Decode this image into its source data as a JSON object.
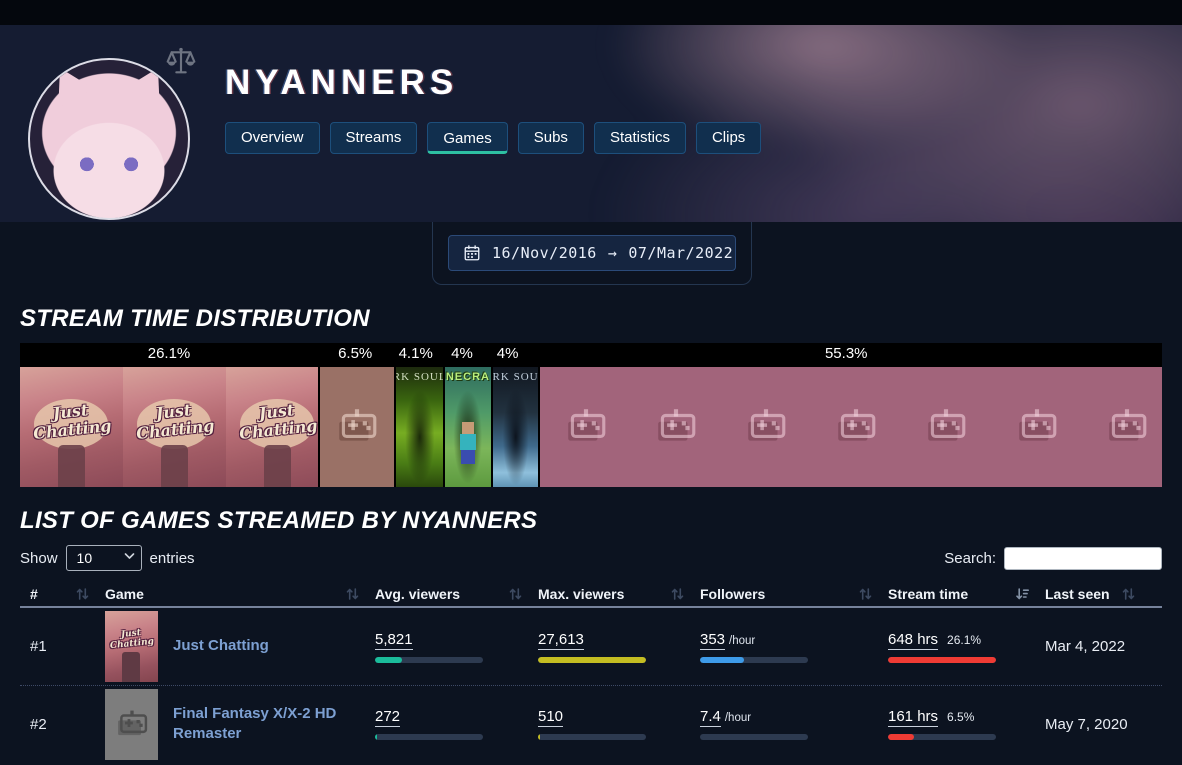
{
  "colors": {
    "accent-active-tab": "#2ec0a2",
    "bar-teal": "#1bbc9b",
    "bar-yellow": "#c4bd22",
    "bar-blue": "#3e9be9",
    "bar-red": "#ef3b34",
    "bar-track": "#2d3a50",
    "link": "#7da0d2"
  },
  "header": {
    "title": "NYANNERS",
    "tabs": [
      {
        "label": "Overview",
        "active": false
      },
      {
        "label": "Streams",
        "active": false
      },
      {
        "label": "Games",
        "active": true
      },
      {
        "label": "Subs",
        "active": false
      },
      {
        "label": "Statistics",
        "active": false
      },
      {
        "label": "Clips",
        "active": false
      }
    ]
  },
  "date_filter": {
    "start": "16/Nov/2016",
    "arrow": "→",
    "end": "07/Mar/2022"
  },
  "sections": {
    "distribution": "STREAM TIME DISTRIBUTION",
    "games": "LIST OF GAMES STREAMED BY NYANNERS"
  },
  "chart_data": {
    "type": "bar",
    "variant": "stacked-percentage-strip",
    "title": "STREAM TIME DISTRIBUTION",
    "unit": "% of total stream time",
    "segments": [
      {
        "label": "26.1%",
        "value": 26.1,
        "art": "just-chatting",
        "tile_text": "Just Chatting"
      },
      {
        "label": "6.5%",
        "value": 6.5,
        "art": "placeholder-brown",
        "tile_text": ""
      },
      {
        "label": "4.1%",
        "value": 4.1,
        "art": "boxart-green",
        "tile_text": "RK SOUL"
      },
      {
        "label": "4%",
        "value": 4,
        "art": "minecraft",
        "tile_text": "NECRA"
      },
      {
        "label": "4%",
        "value": 4,
        "art": "boxart-blue",
        "tile_text": "RK SOU"
      },
      {
        "label": "55.3%",
        "value": 55.3,
        "art": "placeholder-pink",
        "tile_text": ""
      }
    ]
  },
  "games_section": {
    "show_label": "Show",
    "page_size": "10",
    "entries_label": "entries",
    "search_label": "Search:",
    "search_value": ""
  },
  "table": {
    "columns": [
      {
        "label": "#",
        "sort": "both"
      },
      {
        "label": "Game",
        "sort": "both"
      },
      {
        "label": "Avg. viewers",
        "sort": "both"
      },
      {
        "label": "Max. viewers",
        "sort": "both"
      },
      {
        "label": "Followers",
        "sort": "both"
      },
      {
        "label": "Stream time",
        "sort": "desc"
      },
      {
        "label": "Last seen",
        "sort": "both"
      }
    ],
    "rows": [
      {
        "rank": "#1",
        "game": "Just Chatting",
        "thumb": "just-chatting",
        "avg_viewers": {
          "value": "5,821",
          "bar_pct": 25
        },
        "max_viewers": {
          "value": "27,613",
          "bar_pct": 100
        },
        "followers": {
          "value": "353",
          "unit": "/hour",
          "bar_pct": 41
        },
        "stream_time": {
          "value": "648 hrs",
          "share": "26.1%",
          "bar_pct": 100
        },
        "last_seen": "Mar 4, 2022"
      },
      {
        "rank": "#2",
        "game": "Final Fantasy X/X-2 HD Remaster",
        "thumb": "placeholder",
        "avg_viewers": {
          "value": "272",
          "bar_pct": 2
        },
        "max_viewers": {
          "value": "510",
          "bar_pct": 2
        },
        "followers": {
          "value": "7.4",
          "unit": "/hour",
          "bar_pct": 0
        },
        "stream_time": {
          "value": "161 hrs",
          "share": "6.5%",
          "bar_pct": 24
        },
        "last_seen": "May 7, 2020"
      }
    ]
  }
}
